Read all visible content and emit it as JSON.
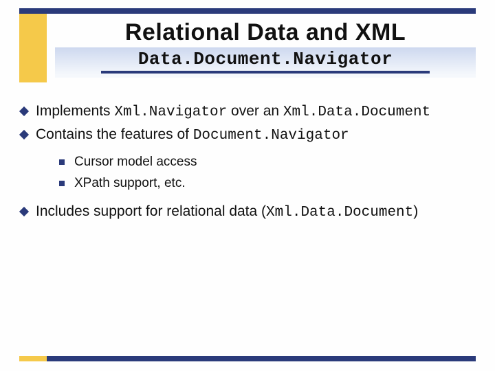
{
  "title": "Relational Data and XML",
  "subtitle": "Data.Document.Navigator",
  "bullets": [
    {
      "segments": [
        {
          "text": "Implements ",
          "mono": false
        },
        {
          "text": "Xml.Navigator",
          "mono": true
        },
        {
          "text": " over an ",
          "mono": false
        },
        {
          "text": "Xml.Data.Document",
          "mono": true
        }
      ]
    },
    {
      "segments": [
        {
          "text": "Contains the features of ",
          "mono": false
        },
        {
          "text": "Document.Navigator",
          "mono": true
        }
      ],
      "sub": [
        "Cursor model access",
        "XPath support, etc."
      ]
    },
    {
      "segments": [
        {
          "text": "Includes support for relational data (",
          "mono": false
        },
        {
          "text": "Xml.Data.Document",
          "mono": true
        },
        {
          "text": ")",
          "mono": false
        }
      ]
    }
  ]
}
